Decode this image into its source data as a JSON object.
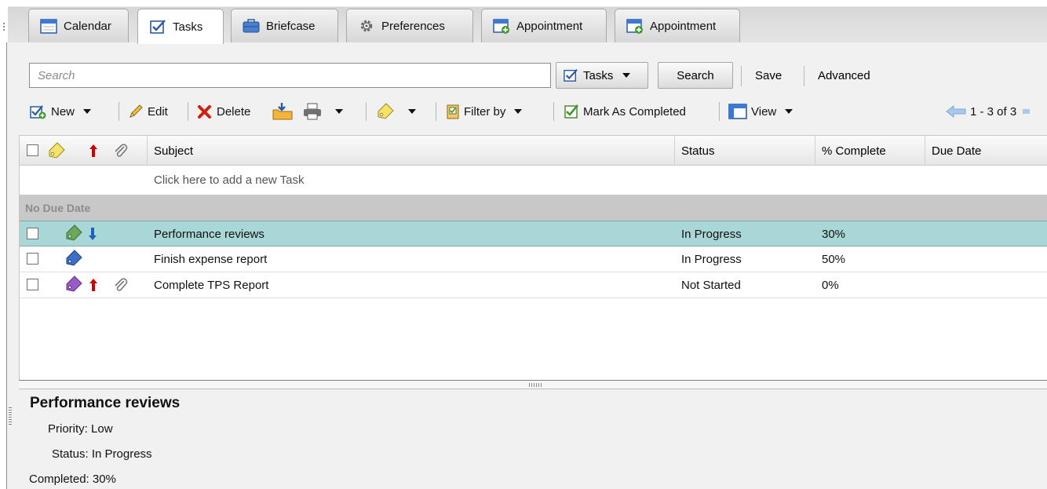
{
  "tabs": [
    {
      "label": "Calendar",
      "icon": "calendar-icon"
    },
    {
      "label": "Tasks",
      "icon": "tasks-checkbox-icon"
    },
    {
      "label": "Briefcase",
      "icon": "briefcase-icon"
    },
    {
      "label": "Preferences",
      "icon": "gear-icon"
    },
    {
      "label": "Appointment",
      "icon": "new-appointment-icon"
    },
    {
      "label": "Appointment",
      "icon": "new-appointment-icon"
    }
  ],
  "search": {
    "placeholder": "Search",
    "type_label": "Tasks",
    "search_label": "Search",
    "save_label": "Save",
    "advanced_label": "Advanced"
  },
  "toolbar": {
    "new_label": "New",
    "edit_label": "Edit",
    "delete_label": "Delete",
    "filter_label": "Filter by",
    "mark_completed_label": "Mark As Completed",
    "view_label": "View",
    "pagination": "1 - 3 of 3"
  },
  "list": {
    "columns": {
      "subject": "Subject",
      "status": "Status",
      "percent": "% Complete",
      "due": "Due Date"
    },
    "new_task_prompt": "Click here to add a new Task",
    "group_label": "No Due Date",
    "tasks": [
      {
        "subject": "Performance reviews",
        "status": "In Progress",
        "percent": "30%",
        "due": "",
        "tag_color": "#6aa85c",
        "priority": "low",
        "attachment": false,
        "selected": true
      },
      {
        "subject": "Finish expense report",
        "status": "In Progress",
        "percent": "50%",
        "due": "",
        "tag_color": "#3d6fc8",
        "priority": "normal",
        "attachment": false,
        "selected": false
      },
      {
        "subject": "Complete TPS Report",
        "status": "Not Started",
        "percent": "0%",
        "due": "",
        "tag_color": "#9a5bc6",
        "priority": "high",
        "attachment": true,
        "selected": false
      }
    ]
  },
  "reading_pane": {
    "title": "Performance reviews",
    "priority": "Priority: Low",
    "status": "Status: In Progress",
    "completed": "Completed: 30%"
  },
  "colors": {
    "selected_row": "#a9d6d6",
    "group_header": "#c8c8c8",
    "priority_high": "#d00000",
    "priority_low": "#1f5fbf"
  }
}
